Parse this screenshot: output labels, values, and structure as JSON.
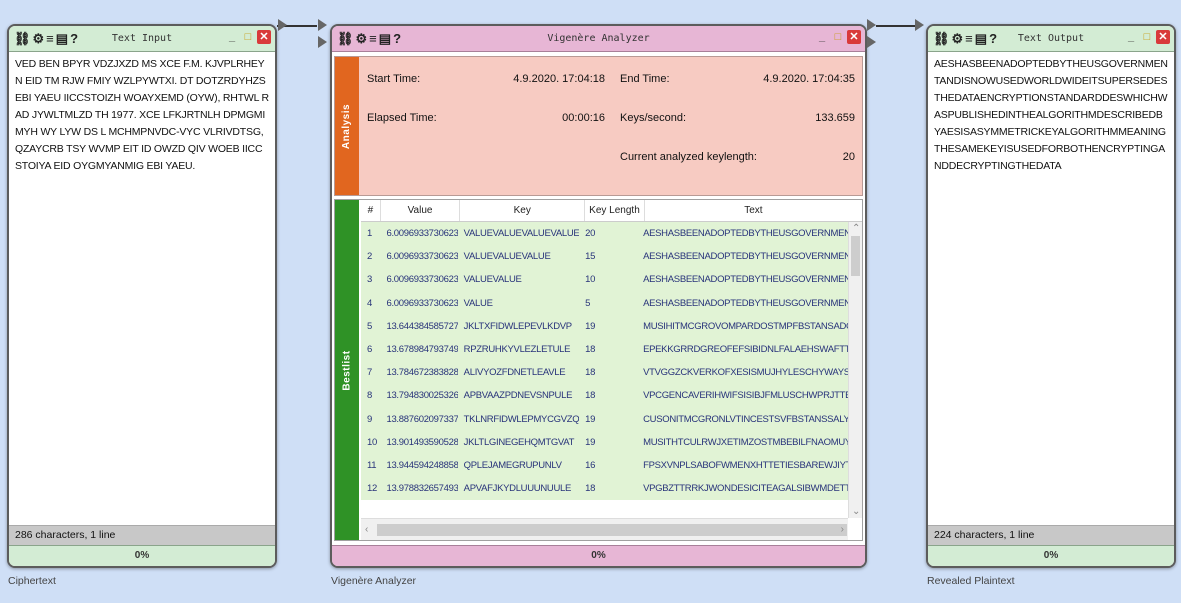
{
  "input": {
    "title": "Text Input",
    "text": "VED BEN BPYR VDZJXZD MS XCE F.M. KJVPLRHEYN EID TM RJW FMIY WZLPYWTXI. DT DOTZRDYHZS EBI YAEU IICCSTOIZH WOAYXEMD (OYW), RHTWL RAD JYWLTMLZD TH 1977. XCE LFKJRTNLH DPMGMIMYH WY LYW DS L MCHMPNVDC-VYC VLRIVDTSG, QZAYCRB TSY WVMP EIT ID OWZD QIV WOEB IICCSTOIYA EID OYGMYANMIG EBI YAEU.",
    "status": "286 characters, 1 line",
    "progress": "0%",
    "caption": "Ciphertext"
  },
  "analyzer": {
    "title": "Vigenère Analyzer",
    "analysis_tab": "Analysis",
    "start_label": "Start Time:",
    "start_value": "4.9.2020. 17:04:18",
    "end_label": "End Time:",
    "end_value": "4.9.2020. 17:04:35",
    "elapsed_label": "Elapsed Time:",
    "elapsed_value": "00:00:16",
    "keys_label": "Keys/second:",
    "keys_value": "133.659",
    "keylen_label": "Current analyzed keylength:",
    "keylen_value": "20",
    "bestlist_tab": "Bestlist",
    "columns": [
      "#",
      "Value",
      "Key",
      "Key Length",
      "Text"
    ],
    "rows": [
      [
        "1",
        "6.00969337306239",
        "VALUEVALUEVALUEVALUE",
        "20",
        "AESHASBEENADOPTEDBYTHEUSGOVERNMENTANDI"
      ],
      [
        "2",
        "6.00969337306239",
        "VALUEVALUEVALUE",
        "15",
        "AESHASBEENADOPTEDBYTHEUSGOVERNMENTANDI"
      ],
      [
        "3",
        "6.00969337306239",
        "VALUEVALUE",
        "10",
        "AESHASBEENADOPTEDBYTHEUSGOVERNMENTANDI"
      ],
      [
        "4",
        "6.00969337306239",
        "VALUE",
        "5",
        "AESHASBEENADOPTEDBYTHEUSGOVERNMENTANDI"
      ],
      [
        "5",
        "13.6443845857273",
        "JKLTXFIDWLEPEVLKDVP",
        "19",
        "MUSIHITMCGROVOMPARDOSTMPFBSTANSADCUFIE"
      ],
      [
        "6",
        "13.6789847937497",
        "RPZRUHKYVLEZLETULE",
        "18",
        "EPEKKGRRDGREOFEFSIBIDNLFALAEHSWAFTTEMENA"
      ],
      [
        "7",
        "13.7846723838286",
        "ALIVYOZFDNETLEAVLE",
        "18",
        "VTVGGZCKVERKOFXESISMUJHYLESCHYWAYSTEDIEW"
      ],
      [
        "8",
        "13.7948300253261",
        "APBVAAZPDNEVSNPULE",
        "18",
        "VPCGENCAVERIHWIFSISIBJFMLUSCHWPRJTTEDELWJ"
      ],
      [
        "9",
        "13.8876020973379",
        "TKLNRFIDWLEPMYCGVZQ",
        "19",
        "CUSONITMCGRONLVTINCESTSVFBSTANSSALYNEDTH"
      ],
      [
        "10",
        "13.9014935905283",
        "JKLTLGINEGEHQMTGVAT",
        "19",
        "MUSITHTCULRWJXETIMZOSTMBEBILFNAOMUYNDAI"
      ],
      [
        "11",
        "13.9445942488584",
        "QPLEJAMEGRUPUNLV",
        "16",
        "FPSXVNPLSABOFWMENXHTTETIESBAREWJIYTEUTAN"
      ],
      [
        "12",
        "13.9788326574939",
        "APVAFJKYDLUUUNUULE",
        "18",
        "VPGBZTTRRKJWONDESICITEAGALSIBWMDETTEDERR"
      ]
    ],
    "progress": "0%",
    "caption": "Vigenère Analyzer"
  },
  "output": {
    "title": "Text Output",
    "text": "AESHASBEENADOPTEDBYTHEUSGOVERNMENTANDISNOWUSEDWORLDWIDEITSUPERSEDESTHEDATAENCRYPTIONSTANDARDDESWHICHWASPUBLISHEDINTHEALGORITHMDESCRIBEDBYAESISASYMMETRICKEYALGORITHMMEANINGTHESAMEKEYISUSEDFORBOTHENCRYPTINGANDDECRYPTINGTHEDATA",
    "status": "224 characters, 1 line",
    "progress": "0%",
    "caption": "Revealed Plaintext"
  },
  "colors": {
    "green_header": "#d3ecd4",
    "pink_header": "#e7b6d5",
    "analysis_bg": "#f7cbc2",
    "analysis_tab": "#e1661f",
    "bestlist_tab": "#2f9226",
    "row_bg": "#e1f3d5",
    "canvas_bg": "#cfdff6"
  },
  "icons": [
    "connector-icon",
    "gear-icon",
    "list-icon",
    "document-icon",
    "help-icon",
    "minimize-icon",
    "maximize-icon",
    "close-icon"
  ]
}
